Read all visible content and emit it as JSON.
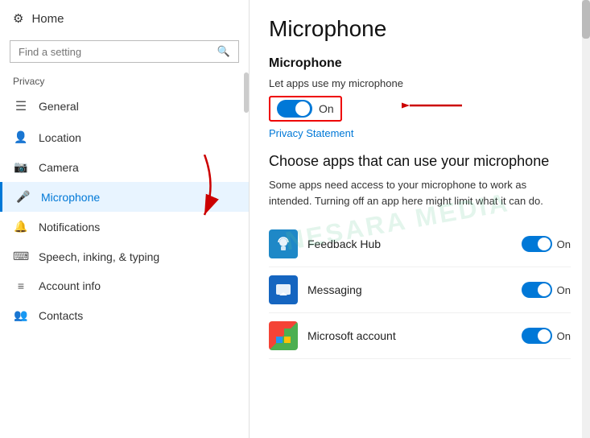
{
  "sidebar": {
    "home_label": "Home",
    "search_placeholder": "Find a setting",
    "privacy_label": "Privacy",
    "items": [
      {
        "id": "general",
        "label": "General",
        "icon": "⊞"
      },
      {
        "id": "location",
        "label": "Location",
        "icon": "📍"
      },
      {
        "id": "camera",
        "label": "Camera",
        "icon": "📷"
      },
      {
        "id": "microphone",
        "label": "Microphone",
        "icon": "🎤",
        "active": true
      },
      {
        "id": "notifications",
        "label": "Notifications",
        "icon": "🔔"
      },
      {
        "id": "speech",
        "label": "Speech, inking, & typing",
        "icon": "🗣"
      },
      {
        "id": "account",
        "label": "Account info",
        "icon": "👤"
      },
      {
        "id": "contacts",
        "label": "Contacts",
        "icon": "👥"
      }
    ]
  },
  "content": {
    "page_title": "Microphone",
    "section_title": "Microphone",
    "toggle_label": "Let apps use my microphone",
    "toggle_state": "On",
    "privacy_statement": "Privacy Statement",
    "choose_title": "Choose apps that can use your microphone",
    "choose_desc": "Some apps need access to your microphone to work as intended. Turning off an app here might limit what it can do.",
    "apps": [
      {
        "name": "Feedback Hub",
        "icon": "feedback",
        "toggle_state": "On"
      },
      {
        "name": "Messaging",
        "icon": "messaging",
        "toggle_state": "On"
      },
      {
        "name": "Microsoft account",
        "icon": "msaccount",
        "toggle_state": "On"
      }
    ]
  },
  "watermark": "NESARA MEDIA"
}
